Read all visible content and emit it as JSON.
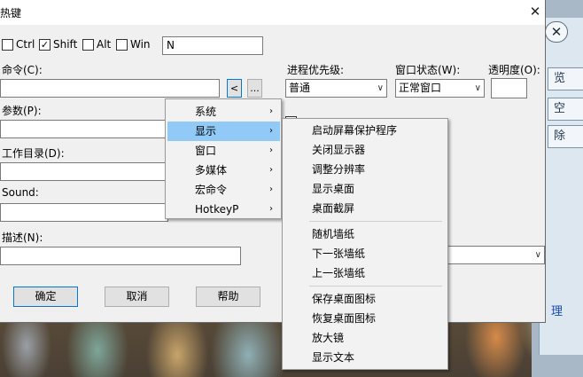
{
  "dialog": {
    "title": "热键",
    "close_symbol": "✕"
  },
  "modifiers": {
    "ctrl": {
      "label": "Ctrl",
      "checked": false
    },
    "shift": {
      "label": "Shift",
      "checked": true,
      "mark": "✓"
    },
    "alt": {
      "label": "Alt",
      "checked": false
    },
    "win": {
      "label": "Win",
      "checked": false
    },
    "key_value": "N"
  },
  "fields": {
    "command_label": "命令(C):",
    "browse_arrow": "<",
    "browse_dots": "...",
    "params_label": "参数(P):",
    "workdir_label": "工作目录(D):",
    "sound_label": "Sound:",
    "desc_label": "描述(N):"
  },
  "priority": {
    "label": "进程优先级:",
    "value": "普通"
  },
  "window_state": {
    "label": "窗口状态(W):",
    "value": "正常窗口"
  },
  "opacity": {
    "label": "透明度(O):",
    "value": ""
  },
  "buttons": {
    "ok": "确定",
    "cancel": "取消",
    "help": "帮助"
  },
  "menu1": {
    "items": [
      {
        "label": "系统"
      },
      {
        "label": "显示"
      },
      {
        "label": "窗口"
      },
      {
        "label": "多媒体"
      },
      {
        "label": "宏命令"
      },
      {
        "label": "HotkeyP"
      }
    ],
    "arrow": "›"
  },
  "menu2": {
    "items": [
      {
        "label": "启动屏幕保护程序"
      },
      {
        "label": "关闭显示器"
      },
      {
        "label": "调整分辨率"
      },
      {
        "label": "显示桌面"
      },
      {
        "label": "桌面截屏"
      },
      {
        "label": "随机墙纸"
      },
      {
        "label": "下一张墙纸"
      },
      {
        "label": "上一张墙纸"
      },
      {
        "label": "保存桌面图标"
      },
      {
        "label": "恢复桌面图标"
      },
      {
        "label": "放大镜"
      },
      {
        "label": "显示文本"
      }
    ]
  },
  "back_window": {
    "close_symbol": "✕",
    "btn1": "览",
    "btn2": "空",
    "btn3": "除",
    "link": "理"
  },
  "colors": {
    "menu_highlight": "#91c9f7",
    "accent": "#0078d7"
  }
}
